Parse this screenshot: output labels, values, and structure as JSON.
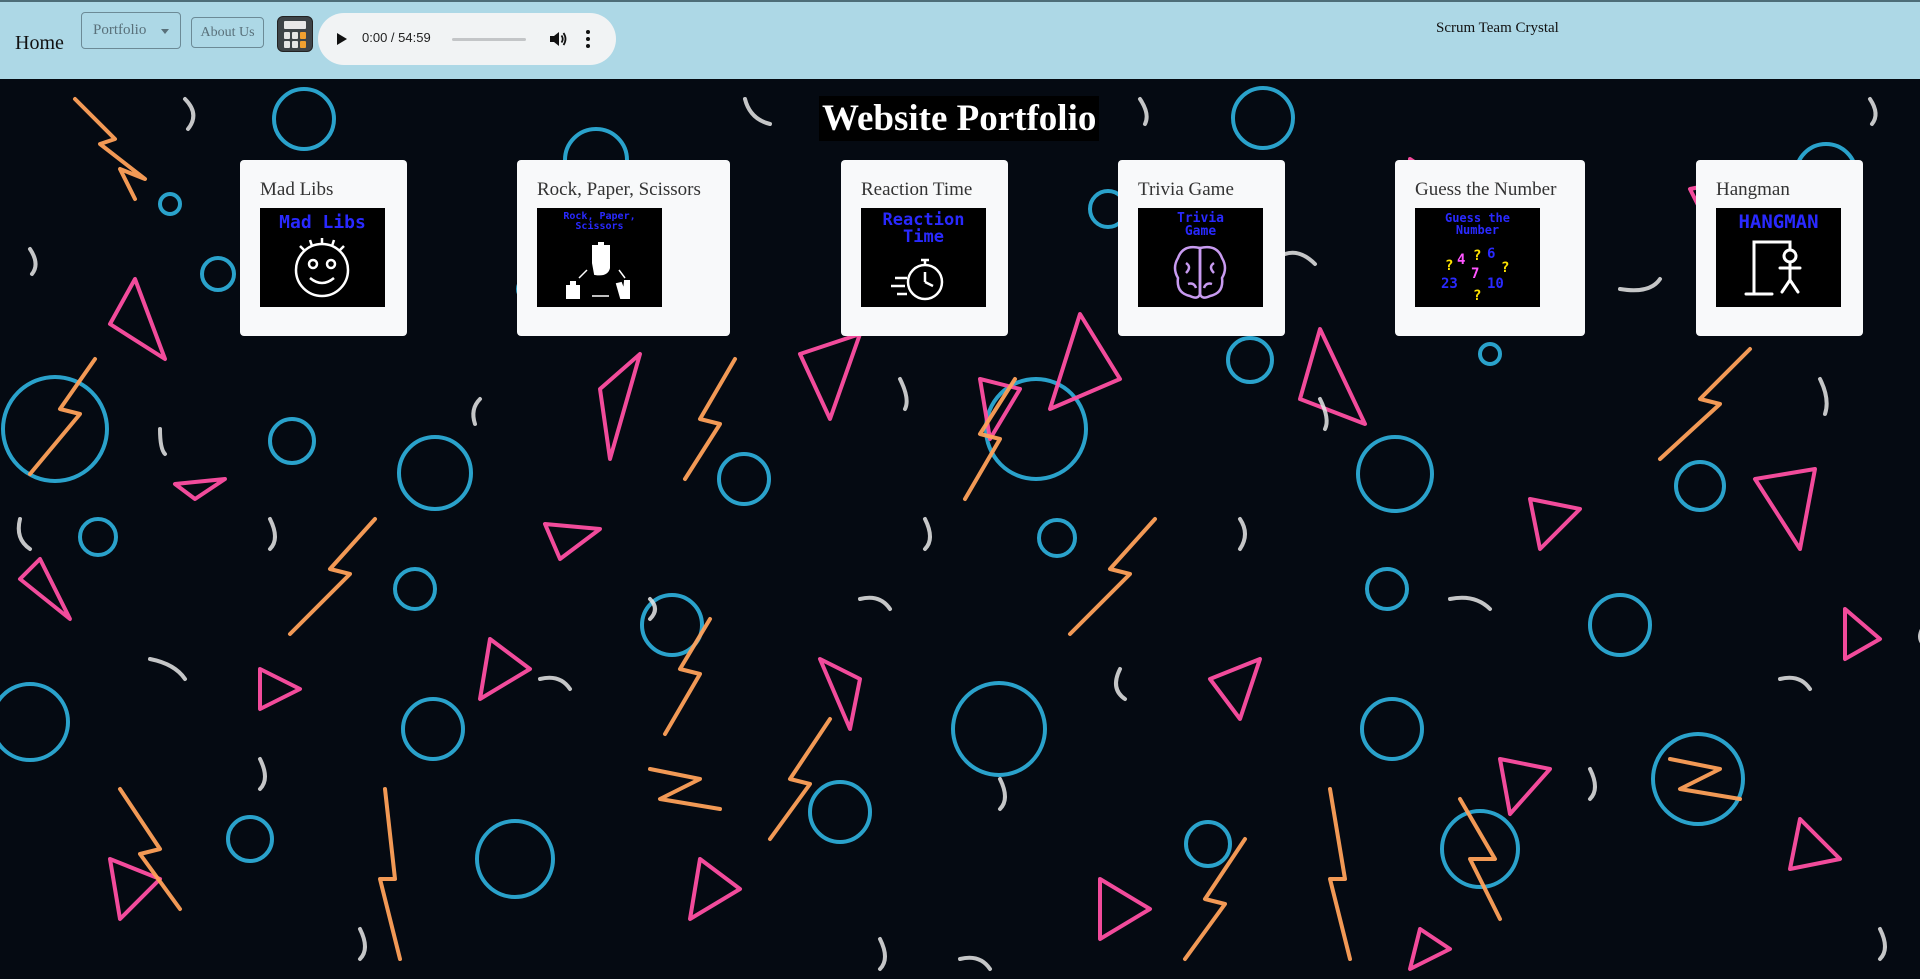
{
  "nav": {
    "home_label": "Home",
    "portfolio_label": "Portfolio",
    "about_label": "About Us",
    "calculator_icon": "calculator-icon",
    "team_name": "Scrum Team Crystal"
  },
  "audio": {
    "time": "0:00 / 54:59",
    "progress": 0,
    "icons": [
      "play-icon",
      "volume-icon",
      "more-options-icon"
    ]
  },
  "page": {
    "title": "Website Portfolio"
  },
  "cards": [
    {
      "title": "Mad Libs",
      "thumb_text": "Mad Libs",
      "icon": "smiley-face-icon"
    },
    {
      "title": "Rock, Paper, Scissors",
      "thumb_text": "Rock, Paper, Scissors",
      "icon": "hand-gestures-icon"
    },
    {
      "title": "Reaction Time",
      "thumb_text": "Reaction Time",
      "icon": "stopwatch-icon"
    },
    {
      "title": "Trivia Game",
      "thumb_text": "Trivia Game",
      "icon": "brain-icon"
    },
    {
      "title": "Guess the Number",
      "thumb_text": "Guess the Number",
      "icon": "numbers-icon"
    },
    {
      "title": "Hangman",
      "thumb_text": "HANGMAN",
      "icon": "gallows-icon"
    }
  ],
  "colors": {
    "navbar": "#add8e6",
    "background": "#050a12",
    "neon_pink": "#ff4fa3",
    "neon_blue": "#2fb3e0",
    "neon_orange": "#ffa15a",
    "thumb_text": "#2929ff"
  }
}
